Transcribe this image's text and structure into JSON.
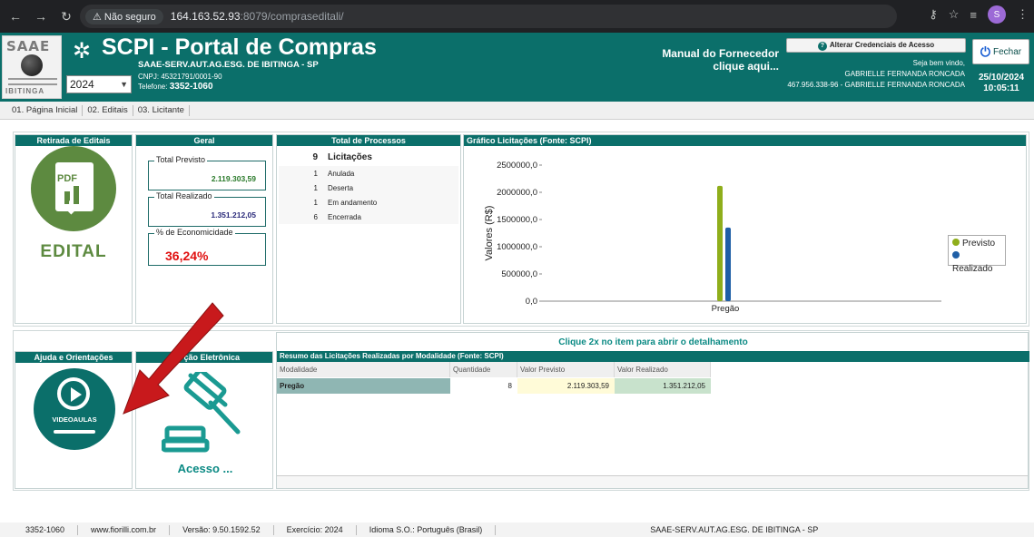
{
  "browser": {
    "security_label": "Não seguro",
    "url_host": "164.163.52.93",
    "url_path": ":8079/compraseditali/",
    "profile_initial": "S"
  },
  "header": {
    "logo_letters": "SAAE",
    "logo_city": "IBITINGA",
    "app_title": "SCPI - Portal de Compras",
    "org_name": "SAAE-SERV.AUT.AG.ESG. DE IBITINGA - SP",
    "cnpj": "CNPJ: 45321791/0001-90",
    "phone_label": "Telefone:",
    "phone_value": "3352-1060",
    "year": "2024",
    "manual_line1": "Manual do Fornecedor",
    "manual_line2": "clique aqui...",
    "credentials_label": "Alterar Credenciais de Acesso",
    "welcome": "Seja bem vindo,",
    "user_name": "GABRIELLE FERNANDA RONCADA",
    "user_doc": "467.956.338-96 - GABRIELLE FERNANDA RONCADA",
    "close_label": "Fechar",
    "date": "25/10/2024",
    "time": "10:05:11"
  },
  "tabs": [
    {
      "label": "01. Página Inicial"
    },
    {
      "label": "02. Editais"
    },
    {
      "label": "03. Licitante"
    }
  ],
  "panels": {
    "retirada": {
      "title": "Retirada de Editais",
      "pdf_label": "PDF",
      "edital_label": "EDITAL"
    },
    "geral": {
      "title": "Geral",
      "total_previsto_label": "Total Previsto",
      "total_previsto": "2.119.303,59",
      "total_realizado_label": "Total Realizado",
      "total_realizado": "1.351.212,05",
      "economicidade_label": "% de Economicidade",
      "economicidade": "36,24%"
    },
    "processos": {
      "title": "Total de Processos",
      "rows": [
        {
          "n": "9",
          "label": "Licitações"
        },
        {
          "n": "1",
          "label": "Anulada"
        },
        {
          "n": "1",
          "label": "Deserta"
        },
        {
          "n": "1",
          "label": "Em andamento"
        },
        {
          "n": "6",
          "label": "Encerrada"
        }
      ]
    },
    "grafico": {
      "title": "Gráfico Licitações (Fonte: SCPI)"
    },
    "ajuda": {
      "title": "Ajuda e Orientações",
      "video_label": "VIDEOAULAS"
    },
    "licitacao": {
      "title": "ção Eletrônica",
      "acesso_label": "Acesso ..."
    },
    "resumo": {
      "hint": "Clique 2x no item para abrir o detalhamento",
      "title": "Resumo das Licitações Realizadas por Modalidade (Fonte: SCPI)",
      "columns": [
        "Modalidade",
        "Quantidade",
        "Valor Previsto",
        "Valor Realizado"
      ],
      "rows": [
        {
          "modalidade": "Pregão",
          "quantidade": "8",
          "previsto": "2.119.303,59",
          "realizado": "1.351.212,05"
        }
      ]
    }
  },
  "chart_data": {
    "type": "bar",
    "title": "Gráfico Licitações (Fonte: SCPI)",
    "categories": [
      "Pregão"
    ],
    "series": [
      {
        "name": "Previsto",
        "values": [
          2119303.59
        ],
        "color": "#8fae1b"
      },
      {
        "name": "Realizado",
        "values": [
          1351212.05
        ],
        "color": "#1f5fa6"
      }
    ],
    "ylabel": "Valores (R$)",
    "xlabel": "",
    "ylim": [
      0,
      2500000
    ],
    "yticks": [
      "0,0",
      "500000,0",
      "1000000,0",
      "1500000,0",
      "2000000,0",
      "2500000,0"
    ],
    "legend_position": "right",
    "grid": false
  },
  "status_bar": {
    "phone": "3352-1060",
    "site": "www.fiorilli.com.br",
    "version": "Versão: 9.50.1592.52",
    "exercise": "Exercício: 2024",
    "language": "Idioma S.O.: Português (Brasil)",
    "org": "SAAE-SERV.AUT.AG.ESG. DE IBITINGA - SP"
  },
  "colors": {
    "header_bg": "#0b6f6a",
    "pdf_green": "#5d8a40",
    "accent_teal": "#0b8a84",
    "economy_red": "#e01010",
    "arrow_red": "#c8191c"
  }
}
